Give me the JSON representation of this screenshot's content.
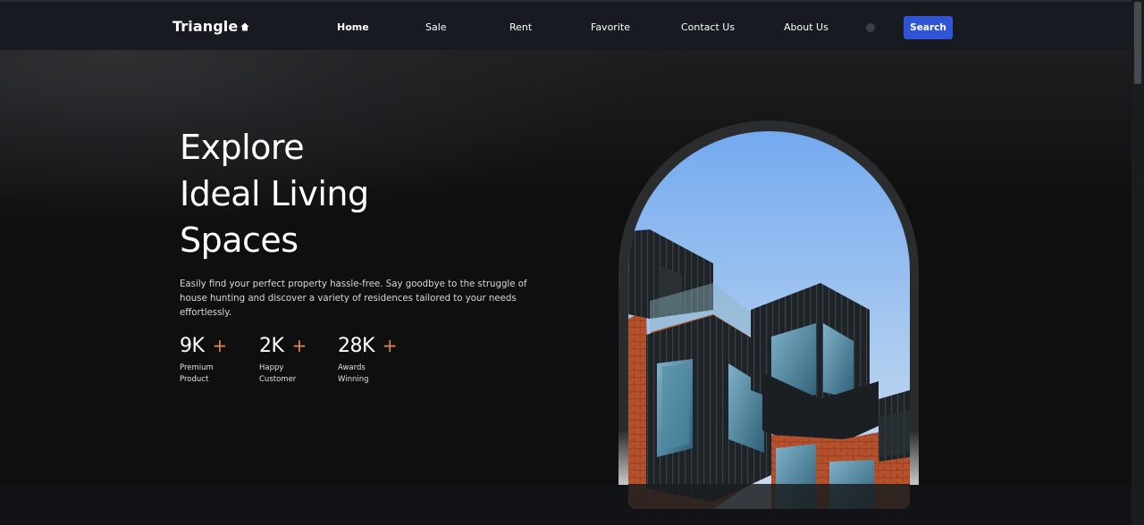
{
  "nav": {
    "brand": "Triangle",
    "items": [
      "Home",
      "Sale",
      "Rent",
      "Favorite",
      "Contact Us",
      "About Us"
    ],
    "search_label": "Search"
  },
  "hero": {
    "title_lines": [
      "Explore",
      "Ideal Living",
      "Spaces"
    ],
    "description": "Easily find your perfect property hassle-free. Say goodbye to the struggle of house hunting and discover a variety of residences tailored to your needs effortlessly.",
    "stats": [
      {
        "value": "9K",
        "plus": "+",
        "label_line1": "Premium",
        "label_line2": "Product"
      },
      {
        "value": "2K",
        "plus": "+",
        "label_line1": "Happy",
        "label_line2": "Customer"
      },
      {
        "value": "28K",
        "plus": "+",
        "label_line1": "Awards",
        "label_line2": "Winning"
      }
    ]
  },
  "colors": {
    "accent": "#2f55d4",
    "plus": "#e0874f",
    "nav_bg": "#171a21",
    "page_bg": "#111216"
  },
  "icons": {
    "brand": "house-icon",
    "theme": "theme-toggle-icon"
  }
}
